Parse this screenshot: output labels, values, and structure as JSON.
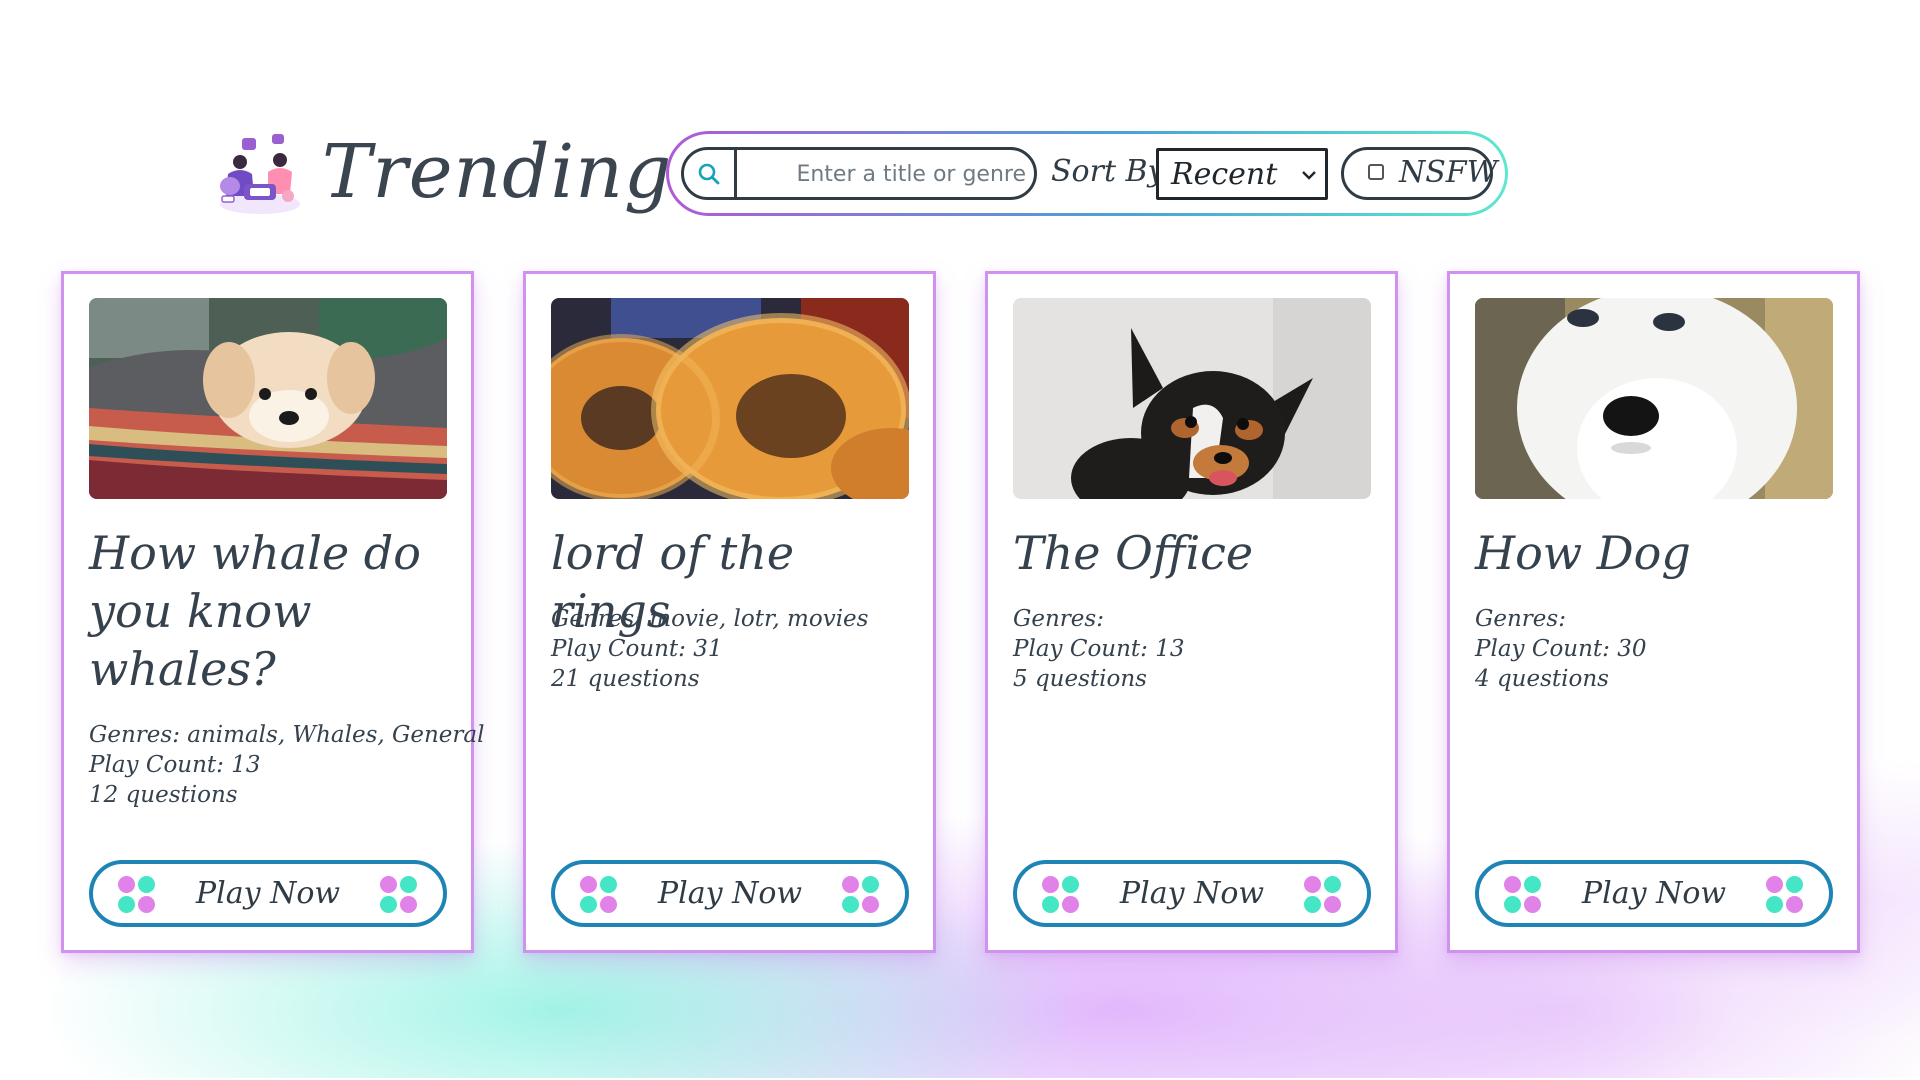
{
  "page": {
    "title": "Trending"
  },
  "search": {
    "placeholder": "Enter a title or genre",
    "value": ""
  },
  "sort": {
    "label": "Sort By:",
    "selected": "Recent"
  },
  "nsfw": {
    "label": "NSFW",
    "checked": false
  },
  "colors": {
    "card_border": "#cf92ef",
    "button_border": "#1d84b5",
    "dot_pink": "#e082e8",
    "dot_teal": "#45e6c6",
    "toolbar_gradient_start": "#b05ad8",
    "toolbar_gradient_end": "#5ee7cf"
  },
  "icons": {
    "logo": "people-playing-game-illustration",
    "search": "search-icon",
    "sort": "chevron-down-icon",
    "play_decoration": "four-dots-icon"
  },
  "cards": [
    {
      "image": "fluffy white dog lying on striped blanket",
      "title": "How whale do you know whales?",
      "genres": "Genres: animals, Whales, General",
      "play_count": "Play Count: 13",
      "questions": "12 questions",
      "button": "Play Now"
    },
    {
      "image": "fried onion rings",
      "title": "lord of the rings",
      "genres": "Genres: movie, lotr, movies",
      "play_count": "Play Count: 31",
      "questions": "21 questions",
      "button": "Play Now"
    },
    {
      "image": "black and tan dog smiling",
      "title": "The Office",
      "genres": "Genres:",
      "play_count": "Play Count: 13",
      "questions": "5 questions",
      "button": "Play Now"
    },
    {
      "image": "white husky puppy close-up",
      "title": "How Dog",
      "genres": "Genres:",
      "play_count": "Play Count: 30",
      "questions": "4 questions",
      "button": "Play Now"
    }
  ]
}
